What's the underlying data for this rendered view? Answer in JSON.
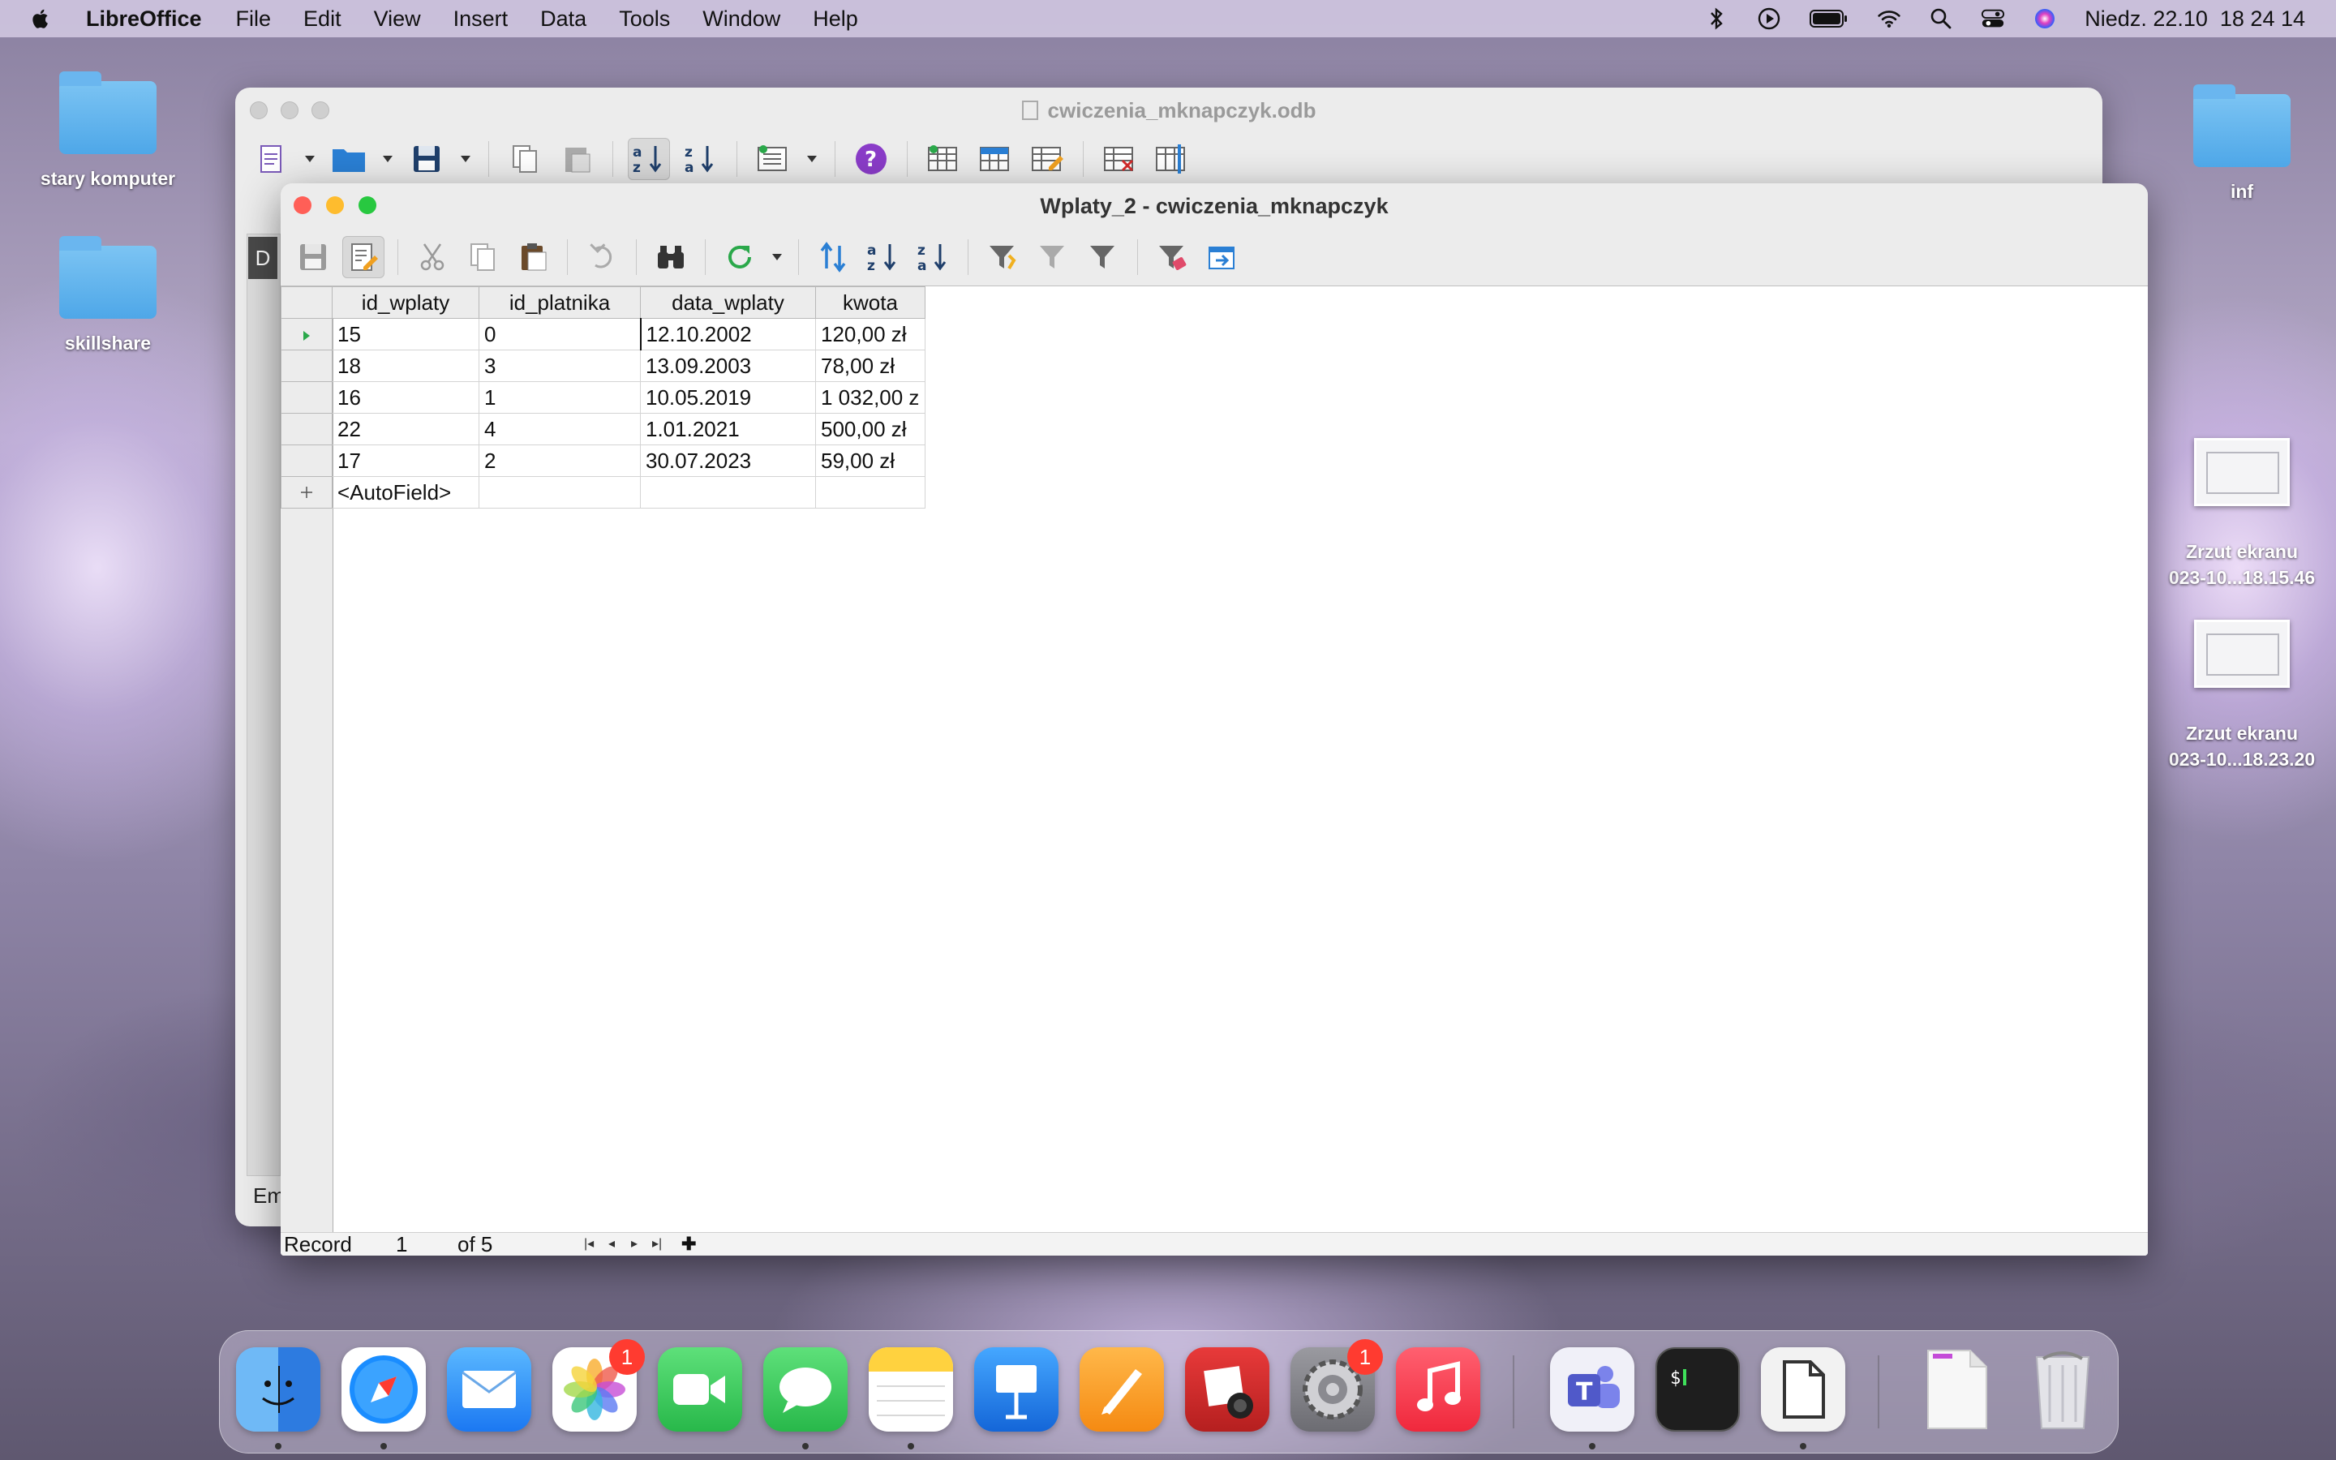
{
  "menubar": {
    "app_name": "LibreOffice",
    "items": [
      "File",
      "Edit",
      "View",
      "Insert",
      "Data",
      "Tools",
      "Window",
      "Help"
    ],
    "clock": "Niedz. 22.10  18 24 14"
  },
  "desktop": {
    "left_icons": [
      {
        "label": "stary komputer",
        "icon": "folder-icon"
      },
      {
        "label": "skillshare",
        "icon": "folder-icon"
      }
    ],
    "right_icons": [
      {
        "label": "inf",
        "icon": "folder-icon"
      },
      {
        "label_line1": "Zrzut ekranu",
        "label_line2": "023-10...18.15.46",
        "icon": "screenshot-thumbnail"
      },
      {
        "label_line1": "Zrzut ekranu",
        "label_line2": "023-10...18.23.20",
        "icon": "screenshot-thumbnail"
      }
    ]
  },
  "back_window": {
    "title": "cwiczenia_mknapczyk.odb",
    "status_text": "Em",
    "side_tab": "D"
  },
  "front_window": {
    "title": "Wplaty_2 - cwiczenia_mknapczyk",
    "columns": [
      "id_wplaty",
      "id_platnika",
      "data_wplaty",
      "kwota"
    ],
    "rows": [
      [
        "15",
        "0",
        "12.10.2002",
        "120,00 zł"
      ],
      [
        "18",
        "3",
        "13.09.2003",
        "78,00 zł"
      ],
      [
        "16",
        "1",
        "10.05.2019",
        "1 032,00 z"
      ],
      [
        "22",
        "4",
        "1.01.2021",
        "500,00 zł"
      ],
      [
        "17",
        "2",
        "30.07.2023",
        "59,00 zł"
      ]
    ],
    "new_row_placeholder": "<AutoField>",
    "status": {
      "record_label": "Record",
      "record_value": "1",
      "of_label": "of 5"
    }
  },
  "dock": {
    "apps": [
      {
        "name": "Finder",
        "color": "#3b8cf0",
        "badge": null,
        "running": true
      },
      {
        "name": "Safari",
        "color": "#1a8dff",
        "badge": null,
        "running": true
      },
      {
        "name": "Mail",
        "color": "#2d8cf6",
        "badge": null,
        "running": false
      },
      {
        "name": "Photos",
        "color": "#f4f4f4",
        "badge": "1",
        "running": false
      },
      {
        "name": "FaceTime",
        "color": "#34c759",
        "badge": null,
        "running": false
      },
      {
        "name": "Messages",
        "color": "#34c759",
        "badge": null,
        "running": true
      },
      {
        "name": "Notes",
        "color": "#ffd23f",
        "badge": null,
        "running": true
      },
      {
        "name": "Keynote",
        "color": "#1f8ef1",
        "badge": null,
        "running": false
      },
      {
        "name": "Pages",
        "color": "#f79a1f",
        "badge": null,
        "running": false
      },
      {
        "name": "Photo Booth",
        "color": "#d62d2d",
        "badge": null,
        "running": false
      },
      {
        "name": "System Settings",
        "color": "#8e8e93",
        "badge": "1",
        "running": false
      },
      {
        "name": "Music",
        "color": "#fc3c44",
        "badge": null,
        "running": false
      },
      {
        "name": "Teams",
        "color": "#5b5fc7",
        "badge": null,
        "running": true
      },
      {
        "name": "Terminal",
        "color": "#1e1e1e",
        "badge": null,
        "running": false
      },
      {
        "name": "LibreOffice",
        "color": "#f2f2f2",
        "badge": null,
        "running": true
      },
      {
        "name": "Document",
        "color": "#f7f7f7",
        "badge": null,
        "running": false
      },
      {
        "name": "Trash",
        "color": "#d9d9de",
        "badge": null,
        "running": false
      }
    ]
  }
}
